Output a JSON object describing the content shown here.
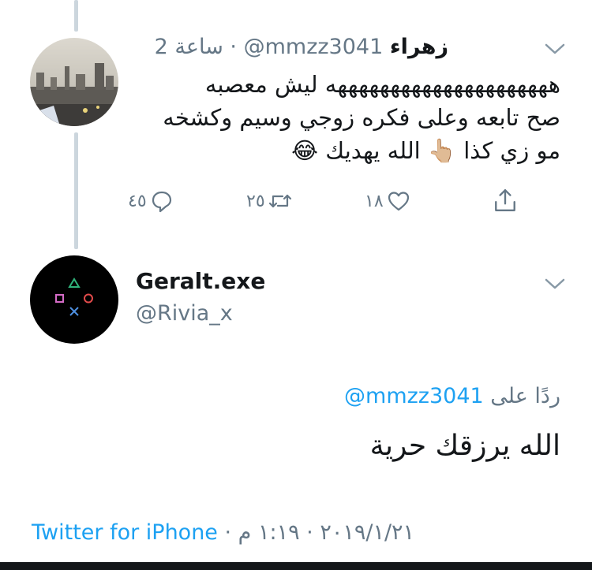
{
  "parent_tweet": {
    "display_name": "زهراء",
    "handle": "@mmzz3041",
    "separator": "·",
    "time_ago": "2 ساعة",
    "text_lines": [
      "هههههههههههههههههههههه ليش معصبه",
      "صح تابعه  وعلى فكره زوجي وسيم وكشخه",
      "مو زي كذا 👆🏼 الله يهديك 😂"
    ],
    "actions": {
      "reply_count": "٤٥",
      "retweet_count": "٢٥",
      "like_count": "١٨"
    }
  },
  "main_tweet": {
    "display_name": "Geralt.exe",
    "handle": "@Rivia_x",
    "reply_prefix": "ردًا على",
    "reply_to_handle": "@mmzz3041",
    "text": "الله يرزقك حرية",
    "source": "Twitter for iPhone",
    "footer_separator": " · ",
    "date": "٢٠١٩/١/٢١",
    "time": "١:١٩ م"
  },
  "colors": {
    "link": "#1da1f2",
    "secondary_text": "#657786",
    "thread_line": "#ccd6dd"
  }
}
